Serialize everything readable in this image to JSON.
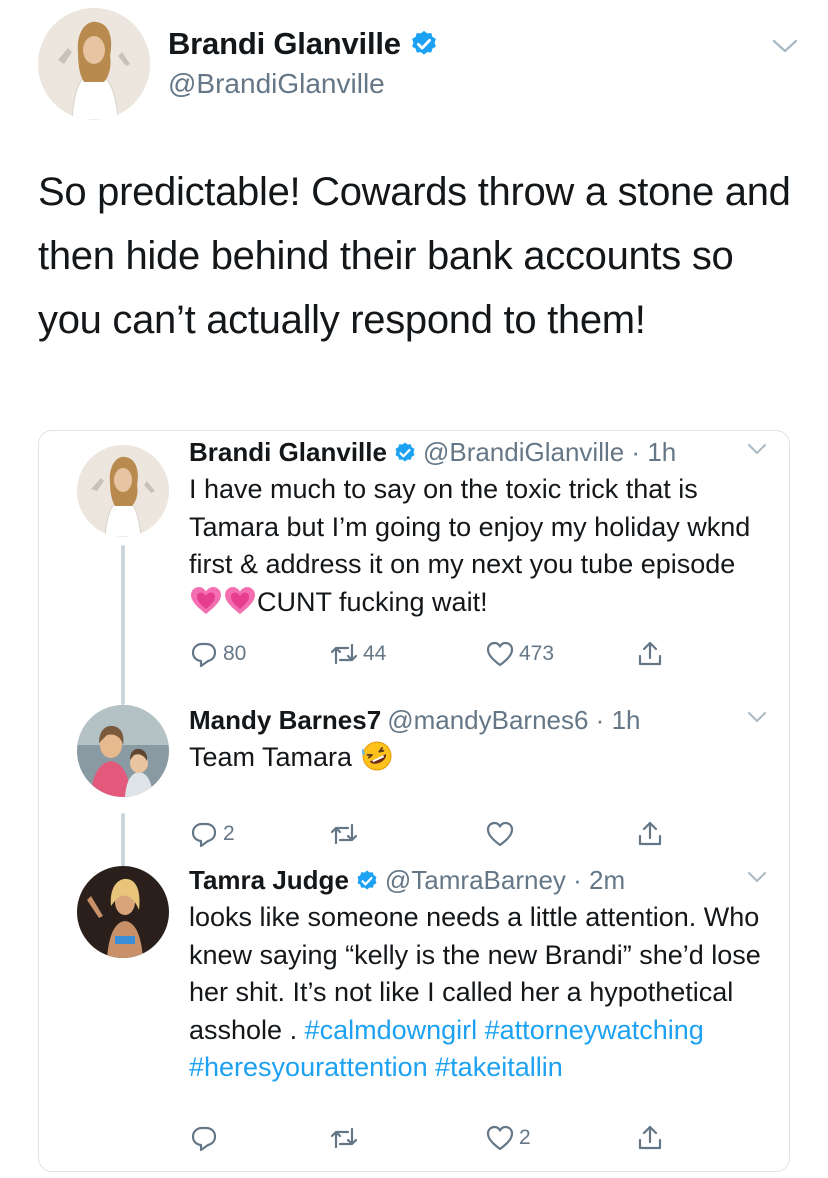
{
  "main_tweet": {
    "display_name": "Brandi Glanville",
    "handle": "@BrandiGlanville",
    "text": "So predictable! Cowards throw a stone and then hide behind their bank accounts so you can’t actually respond to them!"
  },
  "replies": [
    {
      "display_name": "Brandi Glanville",
      "verified": true,
      "handle_time": "@BrandiGlanville · 1h",
      "text_before": "I have much to say on the toxic trick that is Tamara but I’m going to enjoy my holiday wknd first & address it on my next you tube episode ",
      "emoji": [
        "pink-heart-emoji",
        "pink-heart-emoji"
      ],
      "text_after": "CUNT  fucking wait!",
      "stats": {
        "replies": "80",
        "retweets": "44",
        "likes": "473"
      }
    },
    {
      "display_name": "Mandy Barnes7",
      "verified": false,
      "handle_time": "@mandyBarnes6 · 1h",
      "text_before": "Team Tamara ",
      "emoji": [
        "rolling-laughing-emoji"
      ],
      "text_after": "",
      "stats": {
        "replies": "2",
        "retweets": "",
        "likes": ""
      }
    },
    {
      "display_name": "Tamra Judge",
      "verified": true,
      "handle_time": "@TamraBarney · 2m",
      "text_before": "looks like someone needs  a little attention. Who knew saying “kelly  is the new Brandi” she’d lose her shit.  It’s not like I called her a hypothetical asshole . ",
      "hashtags": "#calmdowngirl #attorneywatching #heresyourattention #takeitallin",
      "stats": {
        "replies": "",
        "retweets": "",
        "likes": "2"
      }
    }
  ],
  "colors": {
    "accent": "#1da1f2",
    "text": "#14171a",
    "muted": "#657786",
    "border": "#dfe3e7"
  },
  "icons": [
    "verified-badge-icon",
    "chevron-down-icon",
    "reply-icon",
    "retweet-icon",
    "like-icon",
    "share-icon"
  ]
}
